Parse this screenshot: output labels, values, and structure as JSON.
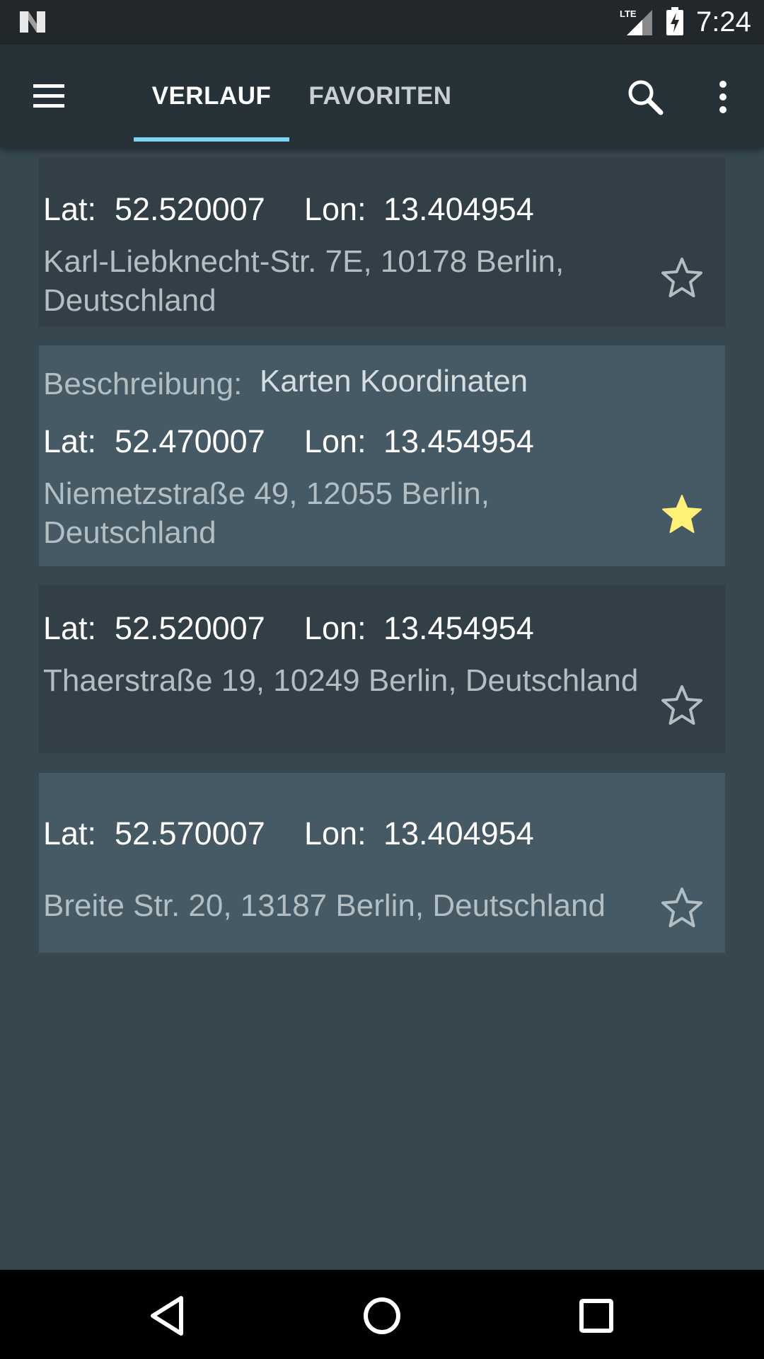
{
  "status_bar": {
    "time": "7:24",
    "network": "LTE",
    "icons": [
      "n-logo-icon",
      "lte-signal-icon",
      "battery-charging-icon"
    ]
  },
  "app_bar": {
    "tabs": [
      {
        "label": "VERLAUF",
        "selected": true
      },
      {
        "label": "FAVORITEN",
        "selected": false
      }
    ],
    "accent_color": "#7ed2f2",
    "icons": [
      "menu-icon",
      "search-icon",
      "overflow-menu-icon"
    ]
  },
  "entries": [
    {
      "lat_label": "Lat:",
      "lat": "52.520007",
      "lon_label": "Lon:",
      "lon": "13.404954",
      "address": "Karl-Liebknecht-Str. 7E, 10178 Berlin, Deutschland",
      "favorite": false
    },
    {
      "description_label": "Beschreibung:",
      "description": "Karten Koordinaten",
      "lat_label": "Lat:",
      "lat": "52.470007",
      "lon_label": "Lon:",
      "lon": "13.454954",
      "address": "Niemetzstraße 49, 12055 Berlin, Deutschland",
      "favorite": true
    },
    {
      "lat_label": "Lat:",
      "lat": "52.520007",
      "lon_label": "Lon:",
      "lon": "13.454954",
      "address": "Thaerstraße 19, 10249 Berlin, Deutschland",
      "favorite": false
    },
    {
      "lat_label": "Lat:",
      "lat": "52.570007",
      "lon_label": "Lon:",
      "lon": "13.404954",
      "address": "Breite Str. 20, 13187 Berlin, Deutschland",
      "favorite": false
    }
  ],
  "colors": {
    "background": "#37474f",
    "card_dark": "#323f47",
    "card_light": "#455a64",
    "favorite_star": "#fff176"
  },
  "nav_bar": {
    "buttons": [
      "back-icon",
      "home-icon",
      "recents-icon"
    ]
  }
}
